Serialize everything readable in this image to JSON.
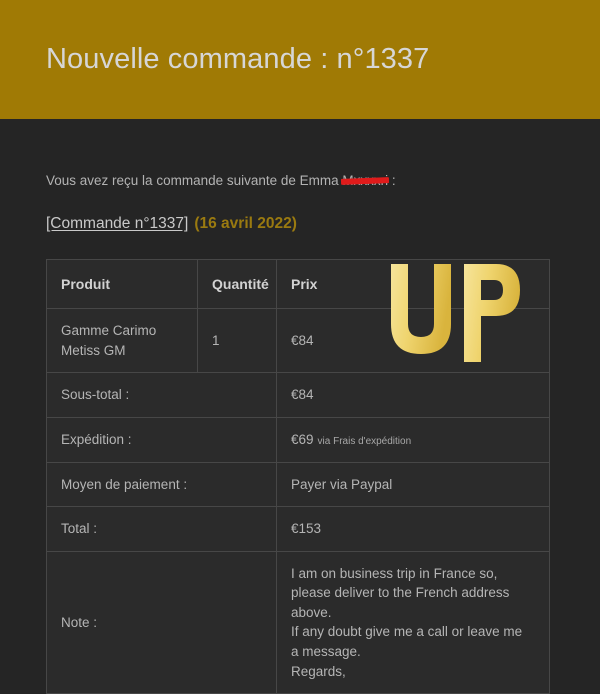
{
  "header": {
    "title": "Nouvelle commande : n°1337",
    "background_color": "#a07a05",
    "text_color": "#d6d6d6"
  },
  "intro": {
    "text_before": "Vous avez reçu la commande suivante de Emma ",
    "customer_first_name": "Emma",
    "redacted_last_name": "Mxxxxri",
    "text_after": " :",
    "redaction_color": "#e01b1b"
  },
  "order_line": {
    "link_label": "[Commande n°1337]",
    "date": "(16 avril 2022)",
    "date_color": "#9a7a10"
  },
  "table": {
    "columns": [
      "Produit",
      "Quantité",
      "Prix"
    ],
    "items": [
      {
        "product": "Gamme Carimo Metiss GM",
        "quantity": "1",
        "price": "€84"
      }
    ],
    "summary": [
      {
        "label": "Sous-total :",
        "value": "€84",
        "suffix": ""
      },
      {
        "label": "Expédition :",
        "value": "€69",
        "suffix": "via Frais d'expédition"
      },
      {
        "label": "Moyen de paiement :",
        "value": "Payer via Paypal",
        "suffix": ""
      },
      {
        "label": "Total :",
        "value": "€153",
        "suffix": ""
      }
    ],
    "note": {
      "label": "Note :",
      "text": "I am on business trip in France so,\nplease deliver to the French address\nabove.\nIf any doubt give me a call or leave me\na message.\nRegards,"
    },
    "border_color": "#474747",
    "cell_background": "#2b2b2b"
  },
  "watermark": {
    "text": "UP",
    "color": "#f0d878"
  },
  "page": {
    "background_color": "#252525"
  }
}
